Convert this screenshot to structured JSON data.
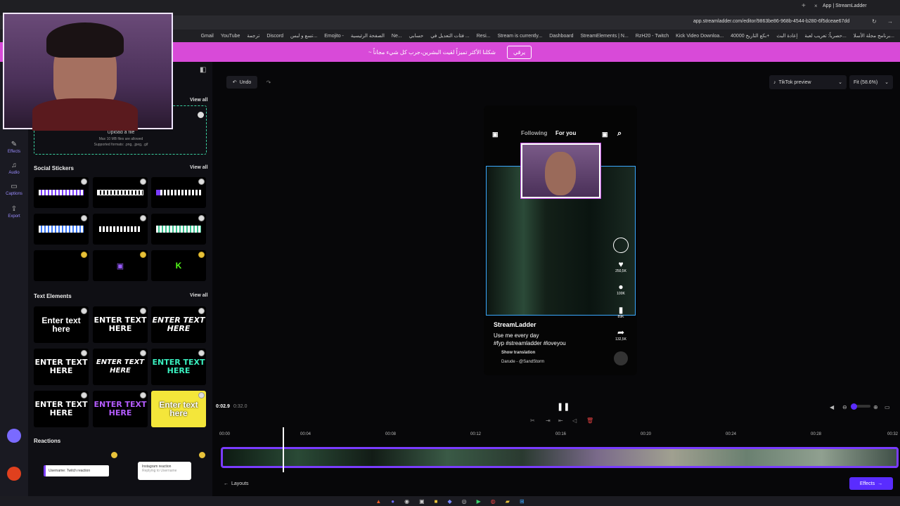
{
  "browser": {
    "tab_title": "App | StreamLadder",
    "url": "app.streamladder.com/editor/9863be86-968b-4544-b280-6f5dceae67dd",
    "bookmarks": [
      "Gmail",
      "YouTube",
      "ترجمة",
      "Discord",
      "تسع و لبس...",
      "Emojito -",
      "الصفحة الرئيسية",
      "Ne...",
      "حسابي",
      "فئات التعديل في ...",
      "Resi...",
      "Stream is currently...",
      "Dashboard",
      "StreamElements | N...",
      "RzH20 - Twitch",
      "Kick Video Downloa...",
      "بكع التاريخ 40000+",
      "إعادة البث",
      "حصرياً: تعريب لعبة...",
      "برنامج مجلة الأسلا..."
    ]
  },
  "banner": {
    "text": "~ شكلنا الأكثر تميزاً لقيت البشرين،جرب كل شيء مجاناً",
    "button": "يرقي"
  },
  "rail": {
    "items": [
      {
        "label": "Effects",
        "icon": "wand-icon"
      },
      {
        "label": "Audio",
        "icon": "music-icon"
      },
      {
        "label": "Captions",
        "icon": "captions-icon"
      },
      {
        "label": "Export",
        "icon": "export-icon"
      }
    ]
  },
  "panel": {
    "view_all": "View all",
    "upload": {
      "title": "Upload a file",
      "limit": "Max 10 MB files are allowed",
      "formats": "Supported formats: .png, .jpeg, .gif"
    },
    "social_stickers_title": "Social Stickers",
    "text_elements_title": "Text Elements",
    "text_elements": [
      "Enter text here",
      "ENTER TEXT HERE",
      "ENTER TEXT HERE",
      "ENTER TEXT HERE",
      "ENTER TEXT HERE",
      "ENTER TEXT HERE",
      "ENTER TEXT HERE",
      "ENTER TEXT HERE",
      "Enter text here"
    ],
    "reactions_title": "Reactions",
    "reaction_twitch": "Username: Twitch reaction",
    "reaction_instagram": "Instagram reaction",
    "reaction_instagram_sub": "Replying to Username"
  },
  "toolbar": {
    "undo": "Undo",
    "preview_mode": "TikTok preview",
    "zoom": "Fit (58.6%)"
  },
  "tiktok": {
    "following": "Following",
    "for_you": "For you",
    "likes": "250,5K",
    "comments": "100K",
    "bookmarks": "89K",
    "shares": "132,5K",
    "username": "StreamLadder",
    "caption": "Use me every day",
    "hashtags": "#fyp #streamladder #loveyou",
    "translation": "Show translation",
    "sound": "Darude - @SandStorm"
  },
  "player": {
    "current_time": "0:02.9",
    "total_time": "0:32.0",
    "ruler": [
      "00:00",
      "00:04",
      "00:08",
      "00:12",
      "00:16",
      "00:20",
      "00:24",
      "00:28",
      "00:32"
    ]
  },
  "bottom": {
    "layouts": "Layouts",
    "effects": "Effects"
  },
  "colors": {
    "accent": "#5a2cff",
    "banner": "#d84ad8",
    "selection": "#3aa8ff"
  }
}
